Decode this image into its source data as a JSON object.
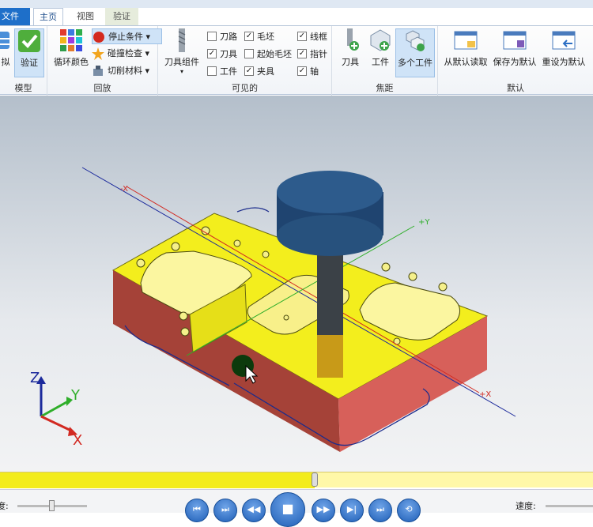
{
  "tabs": {
    "file": "文件",
    "home": "主页",
    "view": "视图",
    "verify": "验证"
  },
  "groups": {
    "model": {
      "label": "模型",
      "btn_partial": "拟",
      "btn_verify": "验证"
    },
    "playback": {
      "label": "回放",
      "cycle_color": "循环颜色",
      "stop_condition": "停止条件",
      "collision_check": "碰撞检查",
      "cut_material": "切削材料"
    },
    "visible": {
      "label": "可见的",
      "tool_assembly": "刀具组件",
      "items": [
        {
          "text": "刀路",
          "checked": false
        },
        {
          "text": "刀具",
          "checked": true
        },
        {
          "text": "工件",
          "checked": false
        },
        {
          "text": "毛坯",
          "checked": true
        },
        {
          "text": "起始毛坯",
          "checked": false
        },
        {
          "text": "夹具",
          "checked": true
        },
        {
          "text": "线框",
          "checked": true
        },
        {
          "text": "指针",
          "checked": true
        },
        {
          "text": "轴",
          "checked": true
        }
      ]
    },
    "focus": {
      "label": "焦距",
      "tool": "刀具",
      "workpiece": "工件",
      "multi": "多个工件"
    },
    "defaults": {
      "label": "默认",
      "load": "从默认读取",
      "save": "保存为默认",
      "reset": "重设为默认"
    }
  },
  "viewport": {
    "axis_labels": {
      "neg_x": "-X",
      "pos_y": "+Y",
      "pos_x": "+X"
    },
    "triad": {
      "x": "X",
      "y": "Y",
      "z": "Z"
    }
  },
  "timeline": {
    "progress_fraction": 0.53
  },
  "controls": {
    "speed_left": "度:",
    "speed_right": "速度:",
    "buttons": [
      "⏮",
      "⏭",
      "◀◀",
      "■",
      "▶▶",
      "▶|",
      "⏭",
      "⟲"
    ]
  },
  "colors": {
    "file_tab": "#1e6fc9",
    "stock_top": "#f3ee1d",
    "stock_side": "#d2544a",
    "tool_head": "#27517d",
    "shank": "#3b4147"
  }
}
